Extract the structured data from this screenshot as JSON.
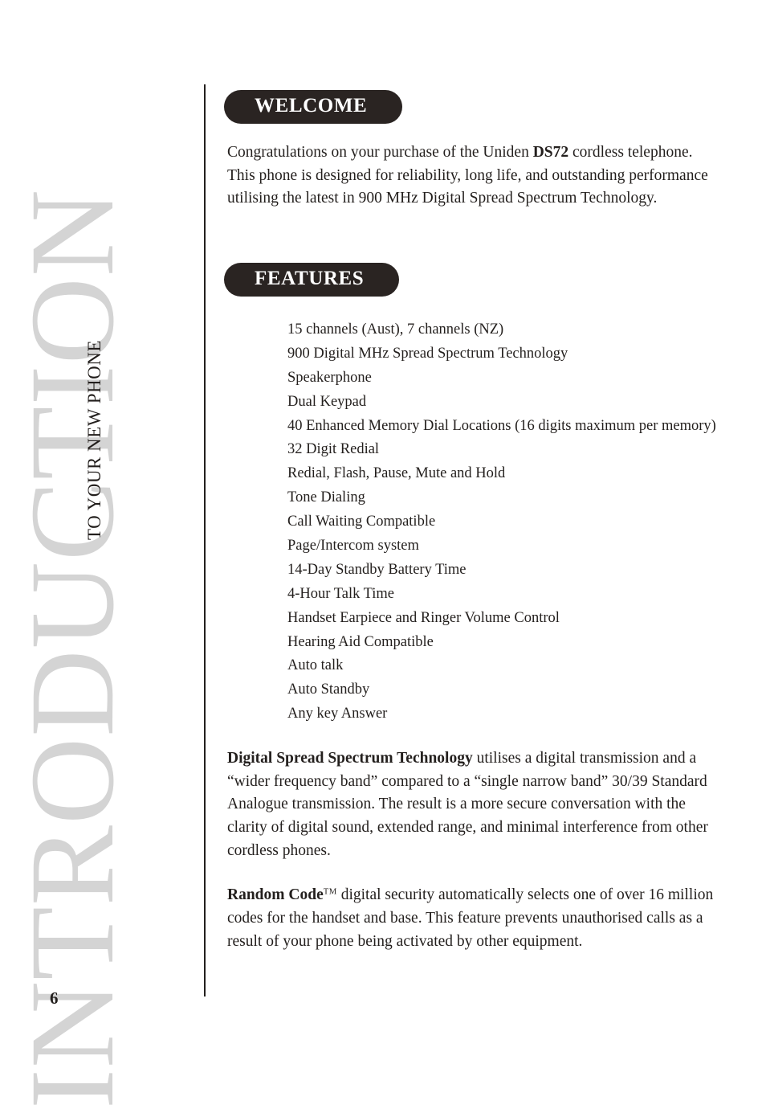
{
  "page": {
    "number": "6",
    "chapter_watermark": "INTRODUCTION",
    "running_head": "TO YOUR NEW PHONE",
    "accent_color": "#2a2422",
    "watermark_color": "#d4d4d4",
    "text_color": "#231f1d"
  },
  "welcome": {
    "heading": "WELCOME",
    "paragraph_before_bold": "Congratulations on your purchase of the Uniden ",
    "paragraph_bold": "DS72",
    "paragraph_after_bold": " cordless telephone. This phone is designed for reliability, long life, and outstanding performance utilising the latest in 900 MHz Digital Spread Spectrum Technology."
  },
  "features": {
    "heading": "FEATURES",
    "items": [
      "15 channels (Aust), 7 channels (NZ)",
      "900 Digital MHz Spread Spectrum Technology",
      "Speakerphone",
      "Dual Keypad",
      "40 Enhanced Memory Dial Locations (16 digits maximum per memory)",
      "32 Digit Redial",
      "Redial, Flash, Pause, Mute and Hold",
      "Tone Dialing",
      "Call Waiting Compatible",
      "Page/Intercom system",
      "14-Day Standby Battery Time",
      "4-Hour Talk Time",
      "Handset Earpiece and Ringer Volume Control",
      "Hearing Aid Compatible",
      "Auto talk",
      "Auto Standby",
      "Any key Answer"
    ]
  },
  "dss": {
    "lead_bold": "Digital Spread Spectrum Technology",
    "body": " utilises a digital transmission and a “wider frequency band” compared to a “single narrow band” 30/39 Standard Analogue transmission. The result is a more secure conversation with the clarity of digital sound, extended range, and minimal interference from other cordless phones."
  },
  "random_code": {
    "lead_bold": "Random Code",
    "trademark": "TM",
    "body": " digital security automatically selects one of over 16 million codes for the handset and base. This feature prevents unauthorised calls as a result of your phone being activated by other equipment."
  }
}
